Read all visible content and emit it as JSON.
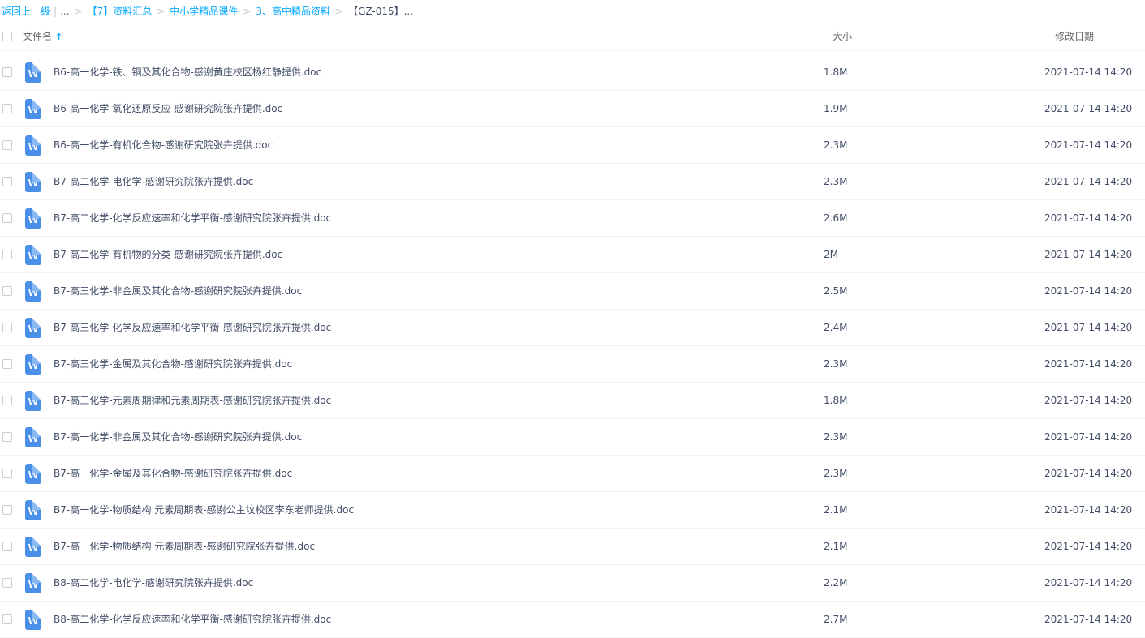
{
  "breadcrumb": {
    "back": "返回上一级",
    "ellipsis": "...",
    "items": [
      "【7】资料汇总",
      "中小学精品课件",
      "3、高中精品资料"
    ],
    "current": "【GZ-015】..."
  },
  "header": {
    "name_label": "文件名",
    "sort_icon": "↑",
    "size_label": "大小",
    "date_label": "修改日期"
  },
  "file_icon": "W",
  "files": [
    {
      "name": "B6-高一化学-铁、铜及其化合物-感谢黄庄校区杨红静提供.doc",
      "size": "1.8M",
      "date": "2021-07-14 14:20"
    },
    {
      "name": "B6-高一化学-氧化还原反应-感谢研究院张卉提供.doc",
      "size": "1.9M",
      "date": "2021-07-14 14:20"
    },
    {
      "name": "B6-高一化学-有机化合物-感谢研究院张卉提供.doc",
      "size": "2.3M",
      "date": "2021-07-14 14:20"
    },
    {
      "name": "B7-高二化学-电化学-感谢研究院张卉提供.doc",
      "size": "2.3M",
      "date": "2021-07-14 14:20"
    },
    {
      "name": "B7-高二化学-化学反应速率和化学平衡-感谢研究院张卉提供.doc",
      "size": "2.6M",
      "date": "2021-07-14 14:20"
    },
    {
      "name": "B7-高二化学-有机物的分类-感谢研究院张卉提供.doc",
      "size": "2M",
      "date": "2021-07-14 14:20"
    },
    {
      "name": "B7-高三化学-非金属及其化合物-感谢研究院张卉提供.doc",
      "size": "2.5M",
      "date": "2021-07-14 14:20"
    },
    {
      "name": "B7-高三化学-化学反应速率和化学平衡-感谢研究院张卉提供.doc",
      "size": "2.4M",
      "date": "2021-07-14 14:20"
    },
    {
      "name": "B7-高三化学-金属及其化合物-感谢研究院张卉提供.doc",
      "size": "2.3M",
      "date": "2021-07-14 14:20"
    },
    {
      "name": "B7-高三化学-元素周期律和元素周期表-感谢研究院张卉提供.doc",
      "size": "1.8M",
      "date": "2021-07-14 14:20"
    },
    {
      "name": "B7-高一化学-非金属及其化合物-感谢研究院张卉提供.doc",
      "size": "2.3M",
      "date": "2021-07-14 14:20"
    },
    {
      "name": "B7-高一化学-金属及其化合物-感谢研究院张卉提供.doc",
      "size": "2.3M",
      "date": "2021-07-14 14:20"
    },
    {
      "name": "B7-高一化学-物质结构 元素周期表-感谢公主坟校区李东老师提供.doc",
      "size": "2.1M",
      "date": "2021-07-14 14:20"
    },
    {
      "name": "B7-高一化学-物质结构 元素周期表-感谢研究院张卉提供.doc",
      "size": "2.1M",
      "date": "2021-07-14 14:20"
    },
    {
      "name": "B8-高二化学-电化学-感谢研究院张卉提供.doc",
      "size": "2.2M",
      "date": "2021-07-14 14:20"
    },
    {
      "name": "B8-高二化学-化学反应速率和化学平衡-感谢研究院张卉提供.doc",
      "size": "2.7M",
      "date": "2021-07-14 14:20"
    }
  ]
}
